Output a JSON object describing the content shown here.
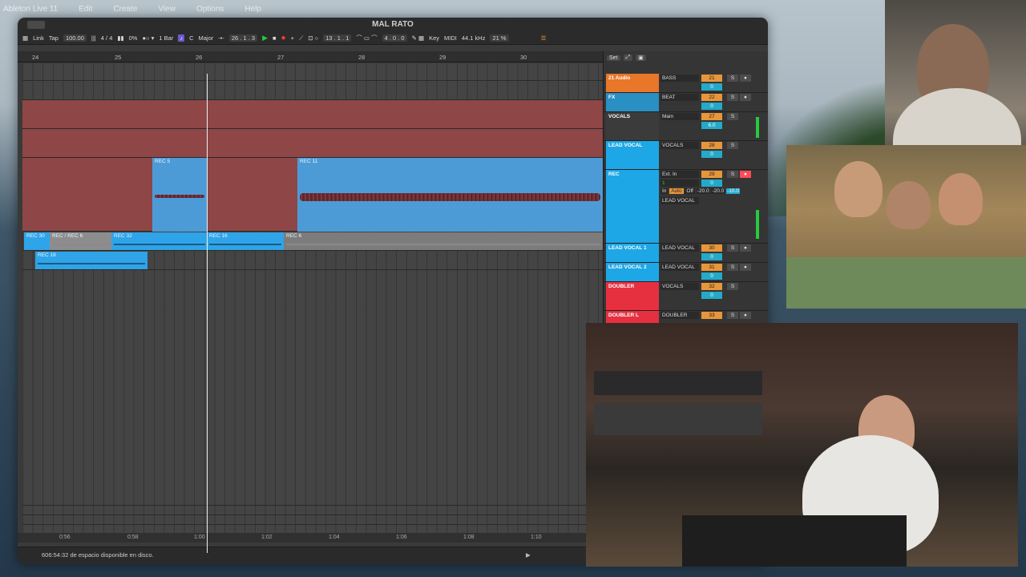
{
  "menubar": {
    "items": [
      "Ableton Live 11",
      "Edit",
      "Create",
      "View",
      "Options",
      "Help"
    ]
  },
  "window": {
    "title": "MAL RATO"
  },
  "toolbar": {
    "link": "Link",
    "tap": "Tap",
    "tempo": "100.00",
    "signature": "4 / 4",
    "groove": "0%",
    "quant": "1 Bar",
    "key_root": "C",
    "scale": "Major",
    "position": "26 .   1 .   3",
    "loop_start": "13 .   1 .   1",
    "loop_length": "4 .   0 .   0",
    "key": "Key",
    "midi": "MIDI",
    "sample_rate": "44.1 kHz",
    "cpu": "21 %"
  },
  "ruler": {
    "bars": [
      "24",
      "25",
      "26",
      "27",
      "28",
      "29",
      "30"
    ]
  },
  "clips": {
    "rec5": "REC 5",
    "rec11": "REC 11",
    "rec30": "REC 30",
    "rec6a": "REC / REC 6",
    "rec32": "REC 32",
    "rec16": "REC 16",
    "rec6b": "REC 6",
    "rec18": "REC 18"
  },
  "timebar": {
    "times": [
      "0:56",
      "0:58",
      "1:00",
      "1:02",
      "1:04",
      "1:06",
      "1:08",
      "1:10"
    ]
  },
  "status": {
    "text": "606:54:32 de espacio disponible en disco."
  },
  "mixer": {
    "set": "Set",
    "strips": [
      {
        "name": "21 Audio",
        "route": "BASS",
        "num": "21",
        "vol": "0",
        "color": "#e8772a"
      },
      {
        "name": "FX",
        "route": "BEAT",
        "num": "22",
        "vol": "0",
        "color": "#2a8fc2"
      },
      {
        "name": "VOCALS",
        "route": "Main",
        "num": "27",
        "vol": "6.0",
        "color": "#3b3b3b"
      },
      {
        "name": "LEAD VOCAL",
        "route": "VOCALS",
        "num": "28",
        "vol": "0",
        "color": "#1ea7e6"
      },
      {
        "name": "REC",
        "route": "Ext. In",
        "num": "29",
        "vol": "0",
        "color": "#1ea7e6",
        "sub1": "1",
        "sub2": "LEAD VOCAL"
      },
      {
        "name": "LEAD VOCAL 1",
        "route": "LEAD VOCAL",
        "num": "30",
        "vol": "0",
        "color": "#1ea7e6"
      },
      {
        "name": "LEAD VOCAL 2",
        "route": "LEAD VOCAL",
        "num": "31",
        "vol": "0",
        "color": "#1ea7e6"
      },
      {
        "name": "DOUBLER",
        "route": "VOCALS",
        "num": "32",
        "vol": "0",
        "color": "#e63040"
      },
      {
        "name": "DOUBLER L",
        "route": "DOUBLER",
        "num": "33",
        "vol": "0",
        "color": "#e63040"
      }
    ],
    "monitor": {
      "in": "In",
      "auto": "Auto",
      "off": "Off",
      "send1": "-20.0",
      "send2": "-20.0",
      "send3": "-10.0"
    }
  }
}
